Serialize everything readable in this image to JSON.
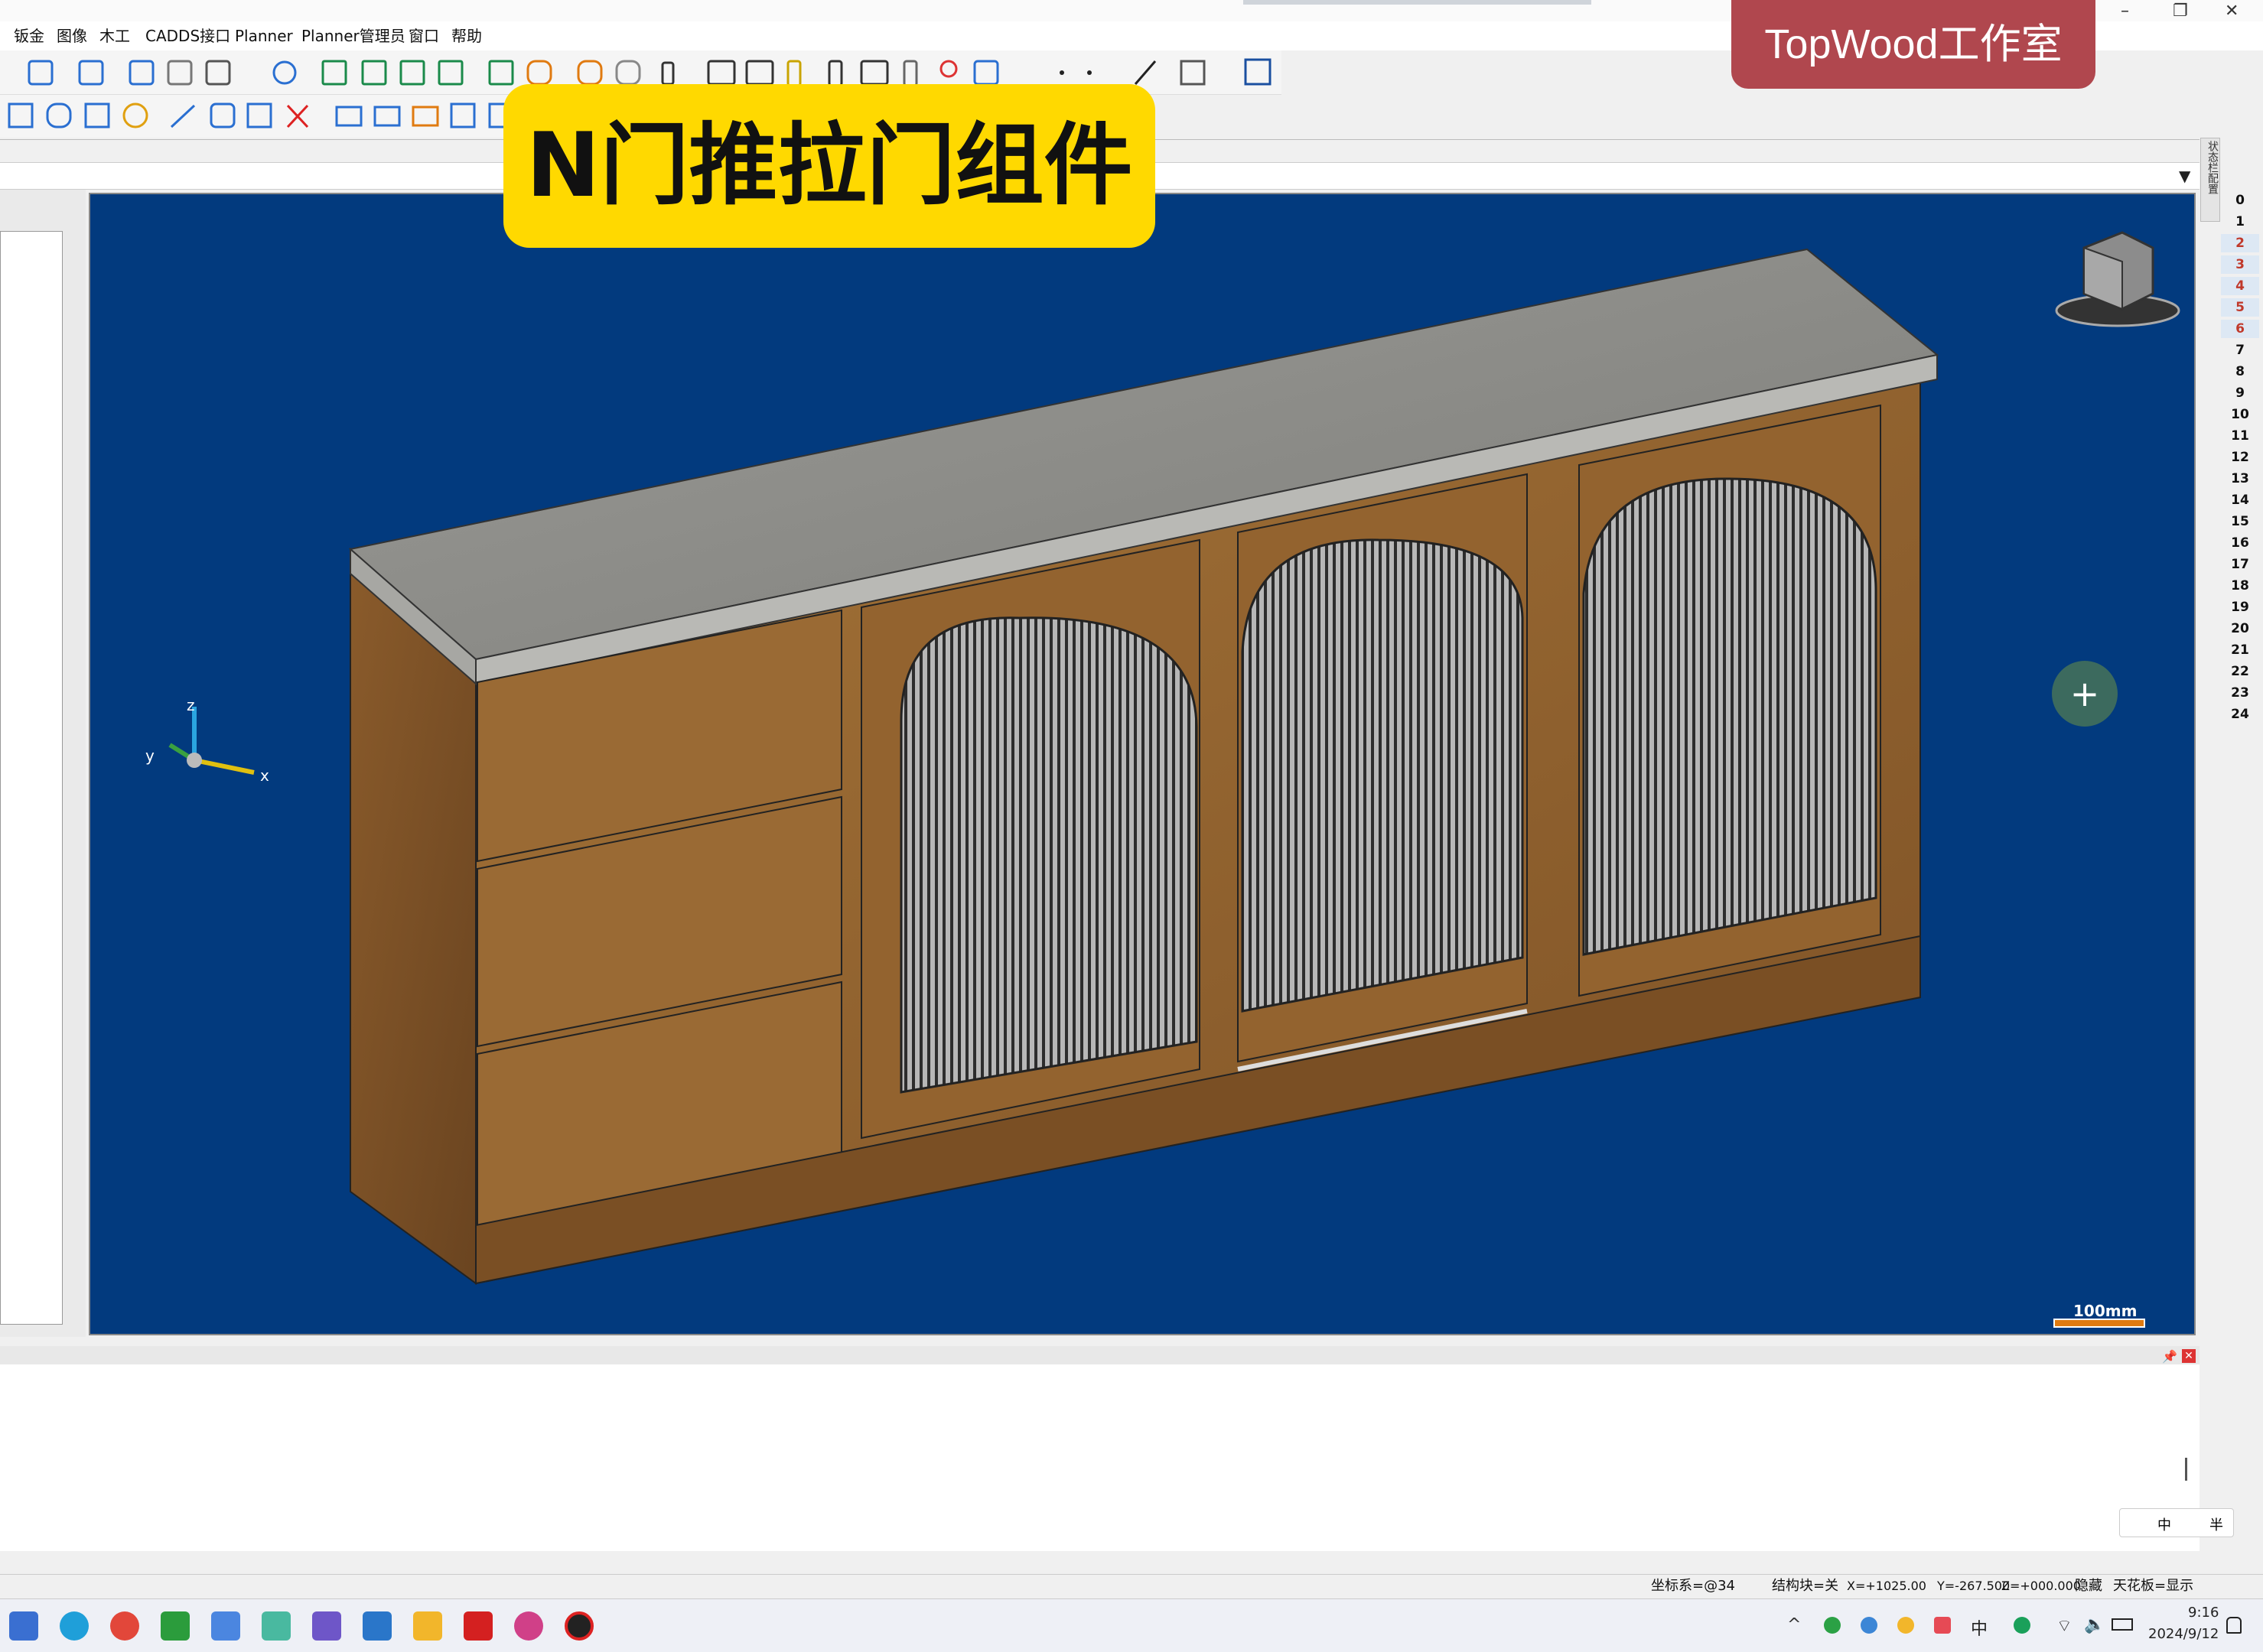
{
  "menu": [
    "钣金",
    "图像",
    "木工",
    "CADDS接口",
    "Planner",
    "Planner管理员",
    "窗口",
    "帮助"
  ],
  "overlay": {
    "title": "N门推拉门组件",
    "brand": "TopWood工作室"
  },
  "window_controls": {
    "minimize": "–",
    "restore": "❐",
    "close": "✕"
  },
  "layers": [
    "0",
    "1",
    "2",
    "3",
    "4",
    "5",
    "6",
    "7",
    "8",
    "9",
    "10",
    "11",
    "12",
    "13",
    "14",
    "15",
    "16",
    "17",
    "18",
    "19",
    "20",
    "21",
    "22",
    "23",
    "24"
  ],
  "selected_layers": [
    "2",
    "3",
    "4",
    "5",
    "6"
  ],
  "side_tab": "状态栏配置",
  "viewport": {
    "scale_label": "100mm",
    "axis_x": "x",
    "axis_y": "y",
    "axis_z": "z"
  },
  "status": {
    "coord_system": "坐标系=@34",
    "block": "结构块=关",
    "x": "X=+1025.00",
    "y": "Y=-267.500",
    "z": "Z=+000.000",
    "hide": "隐藏",
    "ceiling": "天花板=显示"
  },
  "ime": {
    "a": "中",
    "b": "半"
  },
  "tray": {
    "lang": "中",
    "time": "9:16",
    "date": "2024/9/12"
  },
  "colors": {
    "viewport": "#023a7e",
    "banner": "#ffd900",
    "brand": "#b0474e",
    "wood": "#8a5a2b",
    "stone": "#8a8a86"
  }
}
